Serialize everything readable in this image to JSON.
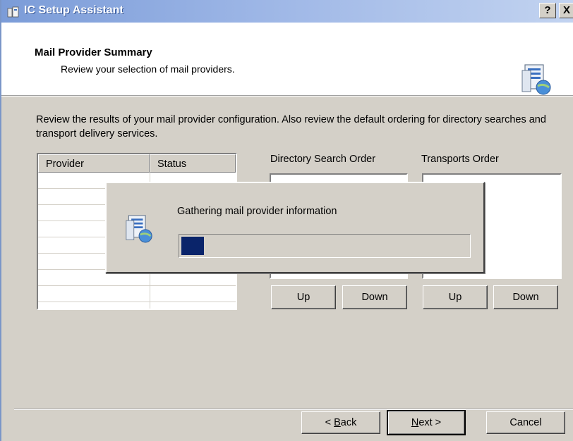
{
  "window": {
    "title": "IC Setup Assistant",
    "help_button": "?",
    "close_button": "X"
  },
  "header": {
    "title": "Mail Provider Summary",
    "subtitle": "Review your selection of mail providers."
  },
  "description": "Review the results of your mail provider configuration. Also review the default ordering for directory searches and transport delivery services.",
  "provider_list": {
    "columns": [
      "Provider",
      "Status"
    ],
    "rows": []
  },
  "directory_search": {
    "label": "Directory Search Order",
    "up": "Up",
    "down": "Down"
  },
  "transports": {
    "label": "Transports Order",
    "up": "Up",
    "down": "Down"
  },
  "progress_dialog": {
    "message": "Gathering mail provider information",
    "progress_fraction": 0.08
  },
  "footer": {
    "back_prefix": "< ",
    "back_key": "B",
    "back_rest": "ack",
    "next_key": "N",
    "next_rest": "ext >",
    "cancel": "Cancel"
  },
  "colors": {
    "titlebar_start": "#7b9cd8",
    "progress_fill": "#0a246a",
    "dialog_face": "#d4d0c8"
  },
  "icons": [
    "setup-assistant-app-icon",
    "mail-provider-icon"
  ]
}
